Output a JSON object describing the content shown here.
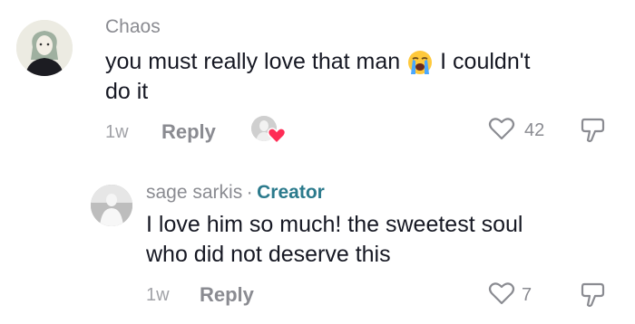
{
  "comments": [
    {
      "username": "Chaos",
      "text_part1": "you must really love that man",
      "emoji_icon": "loudly-crying-face-icon",
      "text_part2": "I couldn't",
      "text_line2": "do it",
      "age": "1w",
      "reply_label": "Reply",
      "like_count": "42",
      "liked_by_creator": true
    },
    {
      "username": "sage sarkis",
      "separator": "·",
      "badge": "Creator",
      "text_line1": "I love him so much! the sweetest soul",
      "text_line2": "who did not deserve this",
      "age": "1w",
      "reply_label": "Reply",
      "like_count": "7"
    }
  ],
  "colors": {
    "creator_badge": "#2b7a8c",
    "heart": "#fe2c55",
    "muted": "#8a8b91"
  }
}
